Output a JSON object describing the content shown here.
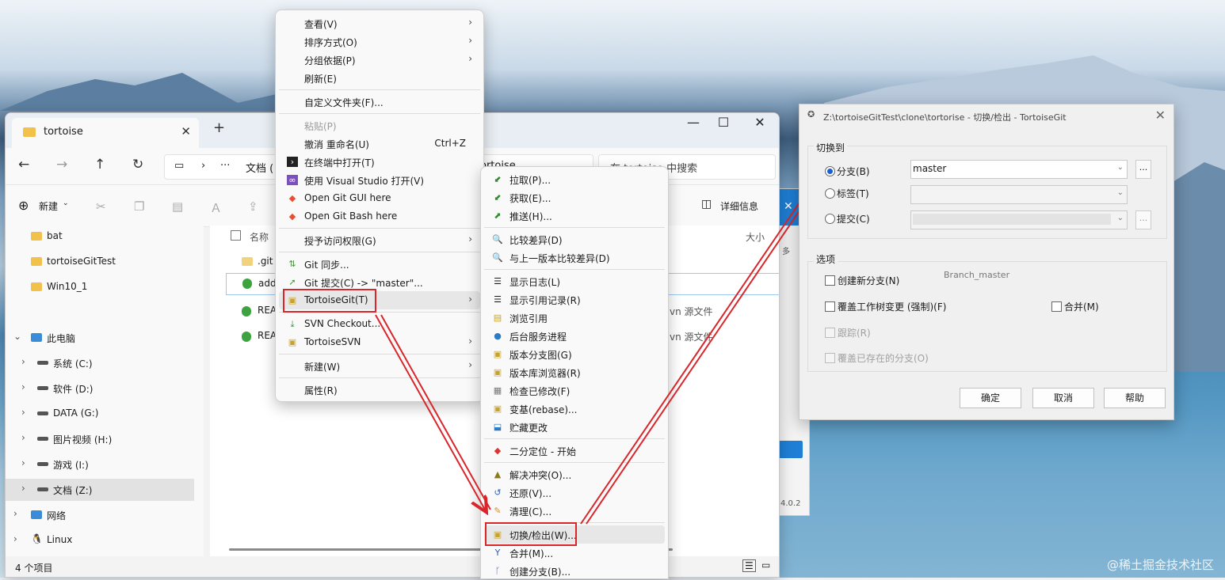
{
  "explorer": {
    "tab_title": "tortoise",
    "address_ellipsis": "···",
    "address_docs": "文档 (",
    "address_folder": "ortoise",
    "search_placeholder": "在 tortoise 中搜索",
    "new_label": "新建",
    "details_label": "详细信息",
    "sidebar": [
      {
        "label": "bat"
      },
      {
        "label": "tortoiseGitTest"
      },
      {
        "label": "Win10_1"
      },
      {
        "label": "此电脑"
      },
      {
        "label": "系统 (C:)"
      },
      {
        "label": "软件 (D:)"
      },
      {
        "label": "DATA (G:)"
      },
      {
        "label": "图片视频 (H:)"
      },
      {
        "label": "游戏 (I:)"
      },
      {
        "label": "文档 (Z:)"
      },
      {
        "label": "网络"
      },
      {
        "label": "Linux"
      }
    ],
    "column_name": "名称",
    "column_size": "大小",
    "files": [
      ".git",
      "add.t",
      "READ",
      "READ"
    ],
    "file_type_1": "vn 源文件",
    "file_type_2": "vn 源文件",
    "status": "4 个项目"
  },
  "context_menu": {
    "items": [
      {
        "label": "查看(V)",
        "arrow": "›"
      },
      {
        "label": "排序方式(O)",
        "arrow": "›"
      },
      {
        "label": "分组依据(P)",
        "arrow": "›"
      },
      {
        "label": "刷新(E)"
      },
      {
        "label": "自定义文件夹(F)..."
      },
      {
        "label": "粘贴(P)"
      },
      {
        "label": "撤消 重命名(U)",
        "shortcut": "Ctrl+Z"
      },
      {
        "label": "在终端中打开(T)"
      },
      {
        "label": "使用 Visual Studio 打开(V)"
      },
      {
        "label": "Open Git GUI here"
      },
      {
        "label": "Open Git Bash here"
      },
      {
        "label": "授予访问权限(G)",
        "arrow": "›"
      },
      {
        "label": "Git 同步..."
      },
      {
        "label": "Git 提交(C) -> \"master\"..."
      },
      {
        "label": "TortoiseGit(T)",
        "arrow": "›"
      },
      {
        "label": "SVN Checkout..."
      },
      {
        "label": "TortoiseSVN",
        "arrow": "›"
      },
      {
        "label": "新建(W)",
        "arrow": "›"
      },
      {
        "label": "属性(R)"
      }
    ]
  },
  "submenu": {
    "items": [
      {
        "label": "拉取(P)..."
      },
      {
        "label": "获取(E)..."
      },
      {
        "label": "推送(H)..."
      },
      {
        "label": "比较差异(D)"
      },
      {
        "label": "与上一版本比较差异(D)"
      },
      {
        "label": "显示日志(L)"
      },
      {
        "label": "显示引用记录(R)"
      },
      {
        "label": "浏览引用"
      },
      {
        "label": "后台服务进程"
      },
      {
        "label": "版本分支图(G)"
      },
      {
        "label": "版本库浏览器(R)"
      },
      {
        "label": "检查已修改(F)"
      },
      {
        "label": "变基(rebase)..."
      },
      {
        "label": "贮藏更改"
      },
      {
        "label": "二分定位 - 开始"
      },
      {
        "label": "解决冲突(O)..."
      },
      {
        "label": "还原(V)..."
      },
      {
        "label": "清理(C)..."
      },
      {
        "label": "切换/检出(W)..."
      },
      {
        "label": "合并(M)..."
      },
      {
        "label": "创建分支(B)..."
      }
    ]
  },
  "dialog": {
    "title": "Z:\\tortoiseGitTest\\clone\\tortorise - 切换/检出 - TortoiseGit",
    "switch_to": "切换到",
    "branch_label": "分支(B)",
    "branch_value": "master",
    "tag_label": "标签(T)",
    "commit_label": "提交(C)",
    "dots": "...",
    "options": "选项",
    "create_branch": "创建新分支(N)",
    "new_branch_name": "Branch_master",
    "override_changes": "覆盖工作树变更 (强制)(F)",
    "merge": "合并(M)",
    "track": "跟踪(R)",
    "override_branch": "覆盖已存在的分支(O)",
    "ok": "确定",
    "cancel": "取消",
    "help": "帮助"
  },
  "background_window": {
    "version": "4.0.2",
    "many": "多"
  },
  "watermark": "@稀土掘金技术社区",
  "colors": {
    "highlight_red": "#d8262b",
    "radio_blue": "#1a5fd0"
  }
}
